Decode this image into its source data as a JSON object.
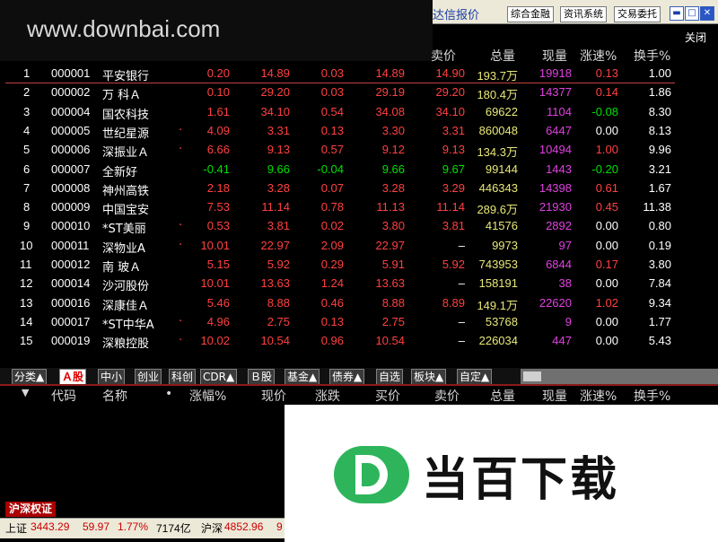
{
  "window": {
    "title_link": "达信报价",
    "buttons": [
      "综合金融",
      "资讯系统",
      "交易委托"
    ],
    "controls": [
      "▬",
      "□",
      "✕"
    ],
    "close_label": "关闭"
  },
  "watermark": "www.downbai.com",
  "table": {
    "columns": [
      "卖价",
      "总量",
      "现量",
      "涨速%",
      "换手%"
    ],
    "rows": [
      {
        "idx": "1",
        "code": "000001",
        "name": "平安银行",
        "mark": "",
        "pct": "0.20",
        "price": "14.89",
        "chg": "0.03",
        "bid": "14.89",
        "ask": "14.90",
        "vol": "193.7万",
        "cur": "19918",
        "spd": "0.13",
        "turn": "1.00",
        "dir": "up"
      },
      {
        "idx": "2",
        "code": "000002",
        "name": "万 科Ａ",
        "mark": "",
        "pct": "0.10",
        "price": "29.20",
        "chg": "0.03",
        "bid": "29.19",
        "ask": "29.20",
        "vol": "180.4万",
        "cur": "14377",
        "spd": "0.14",
        "turn": "1.86",
        "dir": "up"
      },
      {
        "idx": "3",
        "code": "000004",
        "name": "国农科技",
        "mark": "",
        "pct": "1.61",
        "price": "34.10",
        "chg": "0.54",
        "bid": "34.08",
        "ask": "34.10",
        "vol": "69622",
        "cur": "1104",
        "spd": "-0.08",
        "turn": "8.30",
        "dir": "up"
      },
      {
        "idx": "4",
        "code": "000005",
        "name": "世纪星源",
        "mark": "·",
        "pct": "4.09",
        "price": "3.31",
        "chg": "0.13",
        "bid": "3.30",
        "ask": "3.31",
        "vol": "860048",
        "cur": "6447",
        "spd": "0.00",
        "turn": "8.13",
        "dir": "up"
      },
      {
        "idx": "5",
        "code": "000006",
        "name": "深振业Ａ",
        "mark": "·",
        "pct": "6.66",
        "price": "9.13",
        "chg": "0.57",
        "bid": "9.12",
        "ask": "9.13",
        "vol": "134.3万",
        "cur": "10494",
        "spd": "1.00",
        "turn": "9.96",
        "dir": "up"
      },
      {
        "idx": "6",
        "code": "000007",
        "name": "全新好",
        "mark": "",
        "pct": "-0.41",
        "price": "9.66",
        "chg": "-0.04",
        "bid": "9.66",
        "ask": "9.67",
        "vol": "99144",
        "cur": "1443",
        "spd": "-0.20",
        "turn": "3.21",
        "dir": "down"
      },
      {
        "idx": "7",
        "code": "000008",
        "name": "神州高铁",
        "mark": "",
        "pct": "2.18",
        "price": "3.28",
        "chg": "0.07",
        "bid": "3.28",
        "ask": "3.29",
        "vol": "446343",
        "cur": "14398",
        "spd": "0.61",
        "turn": "1.67",
        "dir": "up"
      },
      {
        "idx": "8",
        "code": "000009",
        "name": "中国宝安",
        "mark": "",
        "pct": "7.53",
        "price": "11.14",
        "chg": "0.78",
        "bid": "11.13",
        "ask": "11.14",
        "vol": "289.6万",
        "cur": "21930",
        "spd": "0.45",
        "turn": "11.38",
        "dir": "up"
      },
      {
        "idx": "9",
        "code": "000010",
        "name": "*ST美丽",
        "mark": "·",
        "pct": "0.53",
        "price": "3.81",
        "chg": "0.02",
        "bid": "3.80",
        "ask": "3.81",
        "vol": "41576",
        "cur": "2892",
        "spd": "0.00",
        "turn": "0.80",
        "dir": "up"
      },
      {
        "idx": "10",
        "code": "000011",
        "name": "深物业A",
        "mark": "·",
        "pct": "10.01",
        "price": "22.97",
        "chg": "2.09",
        "bid": "22.97",
        "ask": "–",
        "vol": "9973",
        "cur": "97",
        "spd": "0.00",
        "turn": "0.19",
        "dir": "up"
      },
      {
        "idx": "11",
        "code": "000012",
        "name": "南 玻Ａ",
        "mark": "",
        "pct": "5.15",
        "price": "5.92",
        "chg": "0.29",
        "bid": "5.91",
        "ask": "5.92",
        "vol": "743953",
        "cur": "6844",
        "spd": "0.17",
        "turn": "3.80",
        "dir": "up"
      },
      {
        "idx": "12",
        "code": "000014",
        "name": "沙河股份",
        "mark": "",
        "pct": "10.01",
        "price": "13.63",
        "chg": "1.24",
        "bid": "13.63",
        "ask": "–",
        "vol": "158191",
        "cur": "38",
        "spd": "0.00",
        "turn": "7.84",
        "dir": "up"
      },
      {
        "idx": "13",
        "code": "000016",
        "name": "深康佳Ａ",
        "mark": "",
        "pct": "5.46",
        "price": "8.88",
        "chg": "0.46",
        "bid": "8.88",
        "ask": "8.89",
        "vol": "149.1万",
        "cur": "22620",
        "spd": "1.02",
        "turn": "9.34",
        "dir": "up"
      },
      {
        "idx": "14",
        "code": "000017",
        "name": "*ST中华A",
        "mark": "·",
        "pct": "4.96",
        "price": "2.75",
        "chg": "0.13",
        "bid": "2.75",
        "ask": "–",
        "vol": "53768",
        "cur": "9",
        "spd": "0.00",
        "turn": "1.77",
        "dir": "up"
      },
      {
        "idx": "15",
        "code": "000019",
        "name": "深粮控股",
        "mark": "·",
        "pct": "10.02",
        "price": "10.54",
        "chg": "0.96",
        "bid": "10.54",
        "ask": "–",
        "vol": "226034",
        "cur": "447",
        "spd": "0.00",
        "turn": "5.43",
        "dir": "up"
      }
    ]
  },
  "tabs": [
    "分类▲",
    "Ａ股",
    "中小",
    "创业",
    "科创",
    "CDR▲",
    "Ｂ股",
    "基金▲",
    "债券▲",
    "自选",
    "板块▲",
    "自定▲"
  ],
  "lower_header": [
    "▼",
    "代码",
    "名称",
    "•",
    "涨幅%",
    "现价",
    "涨跌",
    "买价",
    "卖价",
    "总量",
    "现量",
    "涨速%",
    "换手%"
  ],
  "logo_text": "当百下载",
  "market_tab": "沪深权证",
  "status": {
    "sh_label": "上证",
    "sh_value": "3443.29",
    "sh_chg": "59.97",
    "sh_pct": "1.77%",
    "sh_amount": "7174亿",
    "sz_label": "沪深",
    "sz_value": "4852.96",
    "sz_trunc": "9"
  },
  "colors": {
    "up": "#ff4040",
    "down": "#00e000",
    "volume": "#e8e878",
    "current": "#e040e0",
    "white": "#ffffff"
  }
}
